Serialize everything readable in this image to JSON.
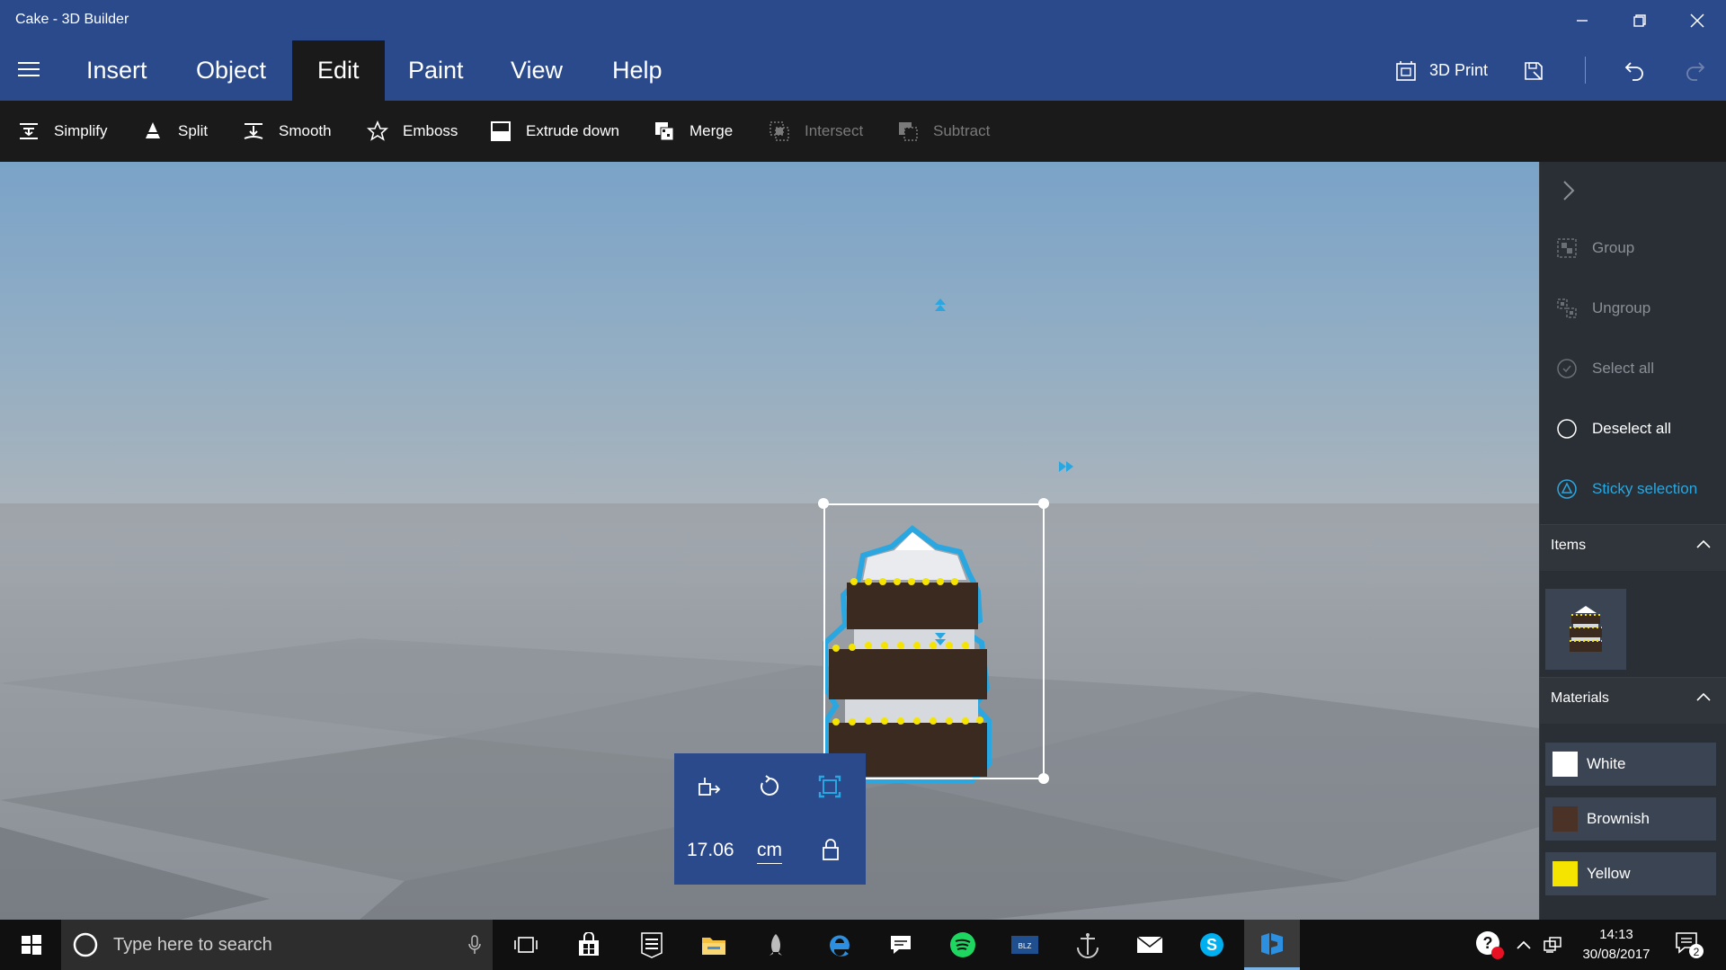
{
  "window": {
    "title": "Cake - 3D Builder",
    "minimize_icon": "minimize-icon",
    "restore_icon": "restore-icon",
    "close_icon": "close-icon"
  },
  "menu": {
    "tabs": [
      {
        "label": "Insert",
        "active": false
      },
      {
        "label": "Object",
        "active": false
      },
      {
        "label": "Edit",
        "active": true
      },
      {
        "label": "Paint",
        "active": false
      },
      {
        "label": "View",
        "active": false
      },
      {
        "label": "Help",
        "active": false
      }
    ],
    "print_label": "3D Print"
  },
  "toolbar": {
    "items": [
      {
        "label": "Simplify",
        "icon": "simplify-icon",
        "enabled": true
      },
      {
        "label": "Split",
        "icon": "split-icon",
        "enabled": true
      },
      {
        "label": "Smooth",
        "icon": "smooth-icon",
        "enabled": true
      },
      {
        "label": "Emboss",
        "icon": "star-icon",
        "enabled": true
      },
      {
        "label": "Extrude down",
        "icon": "extrude-down-icon",
        "enabled": true
      },
      {
        "label": "Merge",
        "icon": "merge-icon",
        "enabled": true
      },
      {
        "label": "Intersect",
        "icon": "intersect-icon",
        "enabled": false
      },
      {
        "label": "Subtract",
        "icon": "subtract-icon",
        "enabled": false
      }
    ]
  },
  "transform": {
    "size_value": "17.06",
    "unit": "cm"
  },
  "side_panel": {
    "actions": [
      {
        "label": "Group",
        "state": "disabled"
      },
      {
        "label": "Ungroup",
        "state": "disabled"
      },
      {
        "label": "Select all",
        "state": "disabled"
      },
      {
        "label": "Deselect all",
        "state": "enabled"
      },
      {
        "label": "Sticky selection",
        "state": "accent"
      }
    ],
    "items_title": "Items",
    "materials_title": "Materials",
    "materials": [
      {
        "label": "White",
        "color": "#ffffff"
      },
      {
        "label": "Brownish",
        "color": "#4a3326"
      },
      {
        "label": "Yellow",
        "color": "#f5e400"
      }
    ]
  },
  "taskbar": {
    "search_placeholder": "Type here to search",
    "time": "14:13",
    "date": "30/08/2017",
    "notification_count": "2"
  },
  "colors": {
    "accent": "#2b4a8c",
    "selection": "#2aa7e0"
  }
}
